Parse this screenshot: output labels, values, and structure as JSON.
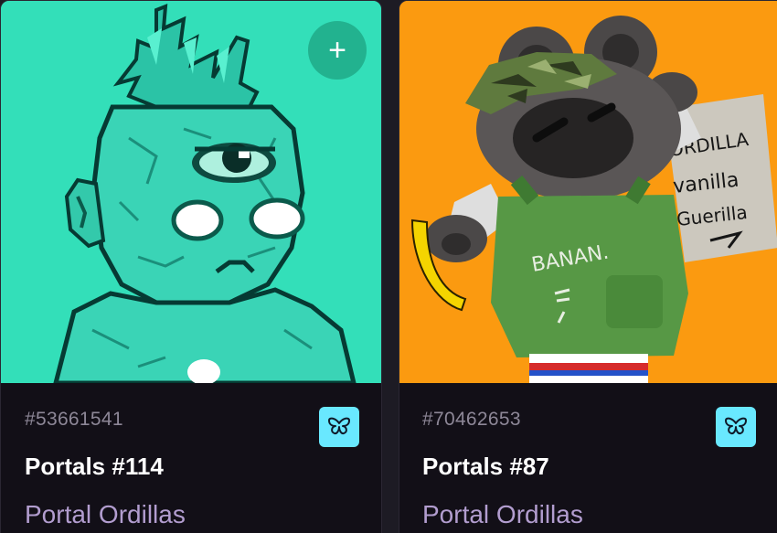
{
  "cards": [
    {
      "token_id": "#53661541",
      "name": "Portals #114",
      "collection": "Portal Ordillas",
      "add_icon": "+",
      "badge_icon": "butterfly-icon",
      "background_color": "#33dfb9"
    },
    {
      "token_id": "#70462653",
      "name": "Portals #87",
      "collection": "Portal Ordillas",
      "badge_icon": "butterfly-icon",
      "background_color": "#fb9a10",
      "artwork_text": {
        "sign_line1": "ORDILLA",
        "sign_line2": "vanilla",
        "sign_line3": "Guerilla",
        "shirt_text": "BANAN."
      }
    }
  ],
  "colors": {
    "card_background": "#120f17",
    "token_id_text": "#8d8797",
    "collection_text": "#b29dcf",
    "badge_background": "#69e8ff"
  }
}
